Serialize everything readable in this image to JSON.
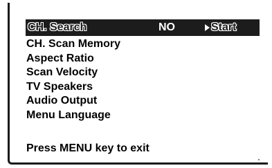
{
  "header": {
    "title": "CH. Search",
    "value": "NO",
    "action_label": "Start",
    "action_icon": "play-arrow-icon"
  },
  "menu": {
    "items": [
      {
        "label": "CH. Scan Memory"
      },
      {
        "label": "Aspect Ratio"
      },
      {
        "label": "Scan Velocity"
      },
      {
        "label": "TV Speakers"
      },
      {
        "label": "Audio Output"
      },
      {
        "label": "Menu Language"
      }
    ]
  },
  "footer": {
    "hint": "Press MENU key to exit"
  },
  "colors": {
    "highlight_bg": "#1c1c1c",
    "highlight_text": "#ffffff",
    "text": "#000000",
    "background": "#ffffff"
  }
}
